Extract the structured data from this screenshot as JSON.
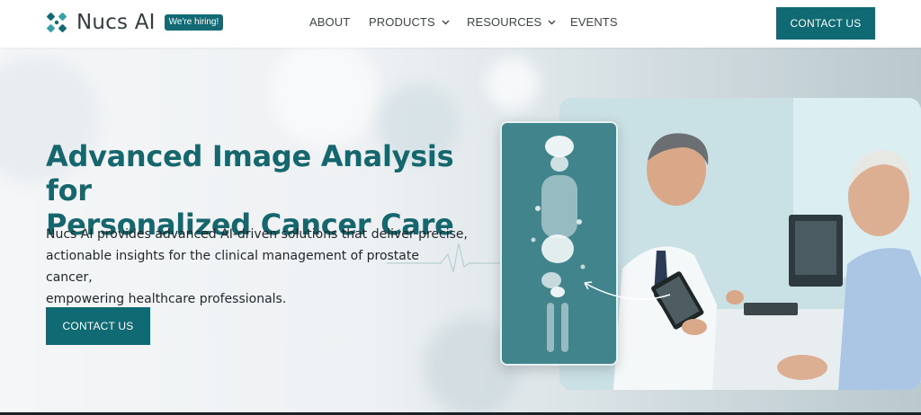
{
  "brand": {
    "name": "Nucs AI",
    "hiring_badge": "We're hiring!"
  },
  "nav": {
    "items": [
      {
        "label": "ABOUT",
        "has_dropdown": false
      },
      {
        "label": "PRODUCTS",
        "has_dropdown": true
      },
      {
        "label": "RESOURCES",
        "has_dropdown": true
      },
      {
        "label": "EVENTS",
        "has_dropdown": false
      }
    ],
    "cta_label": "CONTACT US"
  },
  "hero": {
    "title_line1": "Advanced Image Analysis for",
    "title_line2": "Personalized Cancer Care",
    "description_line1": "Nucs AI provides advanced AI-driven solutions that deliver precise,",
    "description_line2": "actionable insights for the clinical management of prostate cancer,",
    "description_line3": "empowering healthcare professionals.",
    "cta_label": "CONTACT US",
    "image_icon": "doctor-patient-scan-photo"
  },
  "colors": {
    "brand_teal": "#0f6a73",
    "title_teal": "#16666e",
    "text_dark": "#1f2629"
  }
}
